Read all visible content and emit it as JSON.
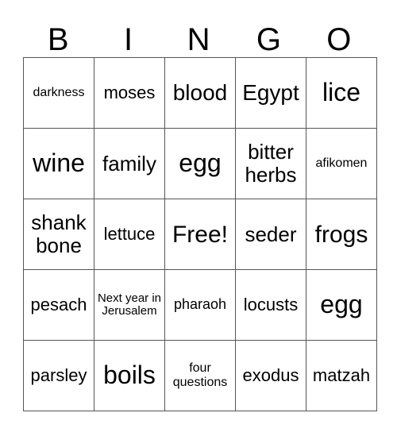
{
  "header": [
    "B",
    "I",
    "N",
    "G",
    "O"
  ],
  "rows": [
    [
      "darkness",
      "moses",
      "blood",
      "Egypt",
      "lice"
    ],
    [
      "wine",
      "family",
      "egg",
      "bitter herbs",
      "afikomen"
    ],
    [
      "shank bone",
      "lettuce",
      "Free!",
      "seder",
      "frogs"
    ],
    [
      "pesach",
      "Next year in Jerusalem",
      "pharaoh",
      "locusts",
      "egg"
    ],
    [
      "parsley",
      "boils",
      "four questions",
      "exodus",
      "matzah"
    ]
  ]
}
